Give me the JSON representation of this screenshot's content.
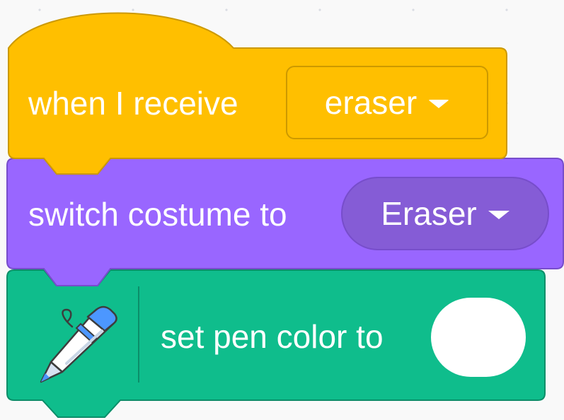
{
  "blocks": {
    "hat": {
      "category": "events",
      "prefix": "when I receive",
      "message": "eraser",
      "color": "#ffbf00",
      "border_color": "#cc9900"
    },
    "looks": {
      "category": "looks",
      "prefix": "switch costume to",
      "costume": "Eraser",
      "color": "#9966ff",
      "border_color": "#774dcb",
      "field_color": "#855cd6"
    },
    "pen": {
      "category": "pen-extension",
      "icon": "pen-icon",
      "prefix": "set pen color to",
      "color_value": "#ffffff",
      "color": "#0fbd8c",
      "border_color": "#0b8e69"
    }
  }
}
